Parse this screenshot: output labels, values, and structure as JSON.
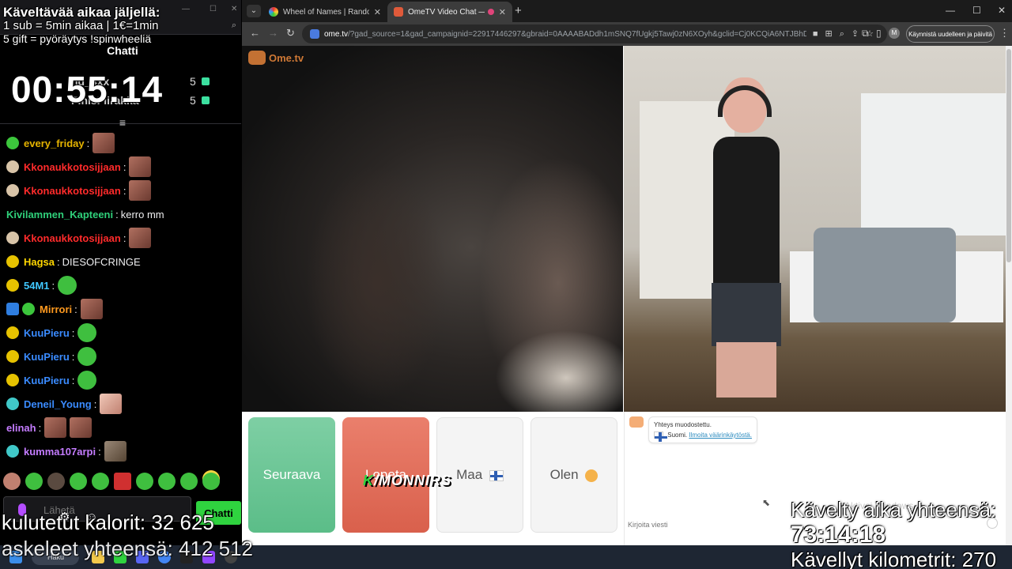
{
  "overlay": {
    "walk_time_left": "Käveltävää aikaa jäljellä:",
    "sub_rule": "1 sub = 5min aikaa | 1€=1min",
    "gift_rule": "5 gift = pyöräytys !spinwheeliä",
    "timer": "00:55:14",
    "calories": "kulutetut kalorit: 32 625",
    "steps": "askeleet yhteensä: 412 512",
    "walked_total_label": "Kävelty aika yhteensä:",
    "walked_total_time": "73:14:18",
    "km_label": "Kävellyt kilometrit: 270",
    "watermark_k": "K",
    "watermark_text": "/MONNIRS"
  },
  "chat": {
    "title": "Chatti",
    "pinned": [
      {
        "user": "hd_4xx",
        "count": "5"
      },
      {
        "user": "FinisFiirakka",
        "count": "5"
      }
    ],
    "messages": [
      {
        "user": "every_friday",
        "color": "#e6b400",
        "text": ""
      },
      {
        "user": "Kkonaukkotosijjaan",
        "color": "#ff2b2b",
        "text": ""
      },
      {
        "user": "Kkonaukkotosijjaan",
        "color": "#ff2b2b",
        "text": ""
      },
      {
        "user": "Kivilammen_Kapteeni",
        "color": "#2fd07a",
        "text": "kerro mm"
      },
      {
        "user": "Kkonaukkotosijjaan",
        "color": "#ff2b2b",
        "text": ""
      },
      {
        "user": "Hagsa",
        "color": "#ffd700",
        "text": "DIESOFCRINGE"
      },
      {
        "user": "54M1",
        "color": "#40c8ff",
        "text": ""
      },
      {
        "user": "Mirrori",
        "color": "#ff9a1f",
        "text": ""
      },
      {
        "user": "KuuPieru",
        "color": "#3a8bff",
        "text": ""
      },
      {
        "user": "KuuPieru",
        "color": "#3a8bff",
        "text": ""
      },
      {
        "user": "KuuPieru",
        "color": "#3a8bff",
        "text": ""
      },
      {
        "user": "Deneil_Young",
        "color": "#3a8bff",
        "text": ""
      },
      {
        "user": "elinah",
        "color": "#c47cff",
        "text": ""
      },
      {
        "user": "kumma107arpi",
        "color": "#c47cff",
        "text": ""
      }
    ],
    "input_placeholder": "Lähetä",
    "send_button": "Chatti"
  },
  "browser": {
    "tabs": [
      {
        "title": "Wheel of Names | Random nam",
        "active": false
      },
      {
        "title": "OmeTV Video Chat — Ome",
        "active": true
      }
    ],
    "url_host": "ome.tv",
    "url_rest": "/?gad_source=1&gad_campaignid=22917446297&gbraid=0AAAABADdh1mSNQ7fUgkj5Tawj0zN6XOyh&gclid=Cj0KCQiA6NTJBhD...",
    "avatar_letter": "M",
    "restart_button": "Käynnistä uudelleen ja päivitä"
  },
  "ometv": {
    "logo": "Ome.tv",
    "next_button": "Seuraava",
    "stop_button": "Lopeta",
    "country_button": "Maa",
    "gender_button": "Olen",
    "system_message_line1": "Yhteys muodostettu.",
    "system_message_country": "Suomi.",
    "report_link": "Ilmoita väärinkäytöstä.",
    "message_placeholder": "Kirjoita viesti",
    "activate_windows": "Aktivoi Windows"
  },
  "taskbar": {
    "search_label": "Haku"
  },
  "colors": {
    "twitch_green": "#2fd33f",
    "ome_next": "#5bbd88",
    "ome_stop": "#d9604c"
  }
}
